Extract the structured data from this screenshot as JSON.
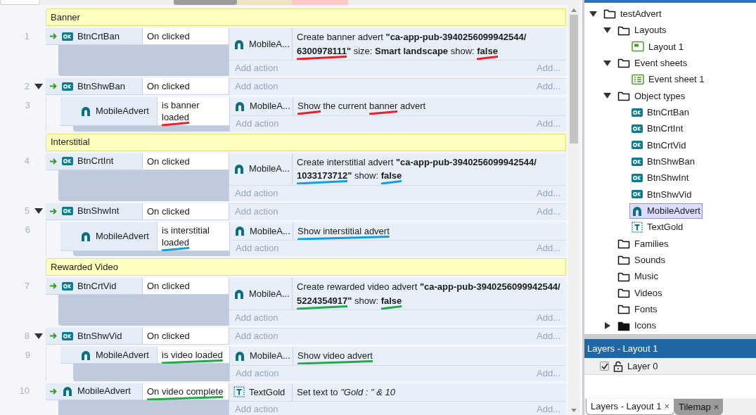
{
  "sheet": {
    "items": [
      {
        "kind": "group",
        "title": "Banner"
      },
      {
        "kind": "event",
        "number": "1",
        "trigger": true,
        "conditions": [
          {
            "kind": "button",
            "object": "BtnCrtBan",
            "text": [
              {
                "text": "On clicked"
              }
            ]
          }
        ],
        "actions": [
          {
            "kind": "advert",
            "object": "MobileA...",
            "text": [
              {
                "text": "Create banner advert "
              },
              {
                "text": "**\"ca-app-pub-**"
              },
              {
                "text": "**3940256099942544/**"
              },
              {
                "text": "**6300978111**",
                "color": "#e8202a"
              },
              {
                "text": "**\"** size: **Smart landscape** show: "
              },
              {
                "text": "**false**",
                "color": "#e8202a"
              }
            ]
          }
        ],
        "add_action": "Add action",
        "add_more": "Add..."
      },
      {
        "kind": "event",
        "number": "2",
        "trigger": true,
        "expanded": true,
        "conditions": [
          {
            "kind": "button",
            "object": "BtnShwBan",
            "text": [
              {
                "text": "On clicked"
              }
            ]
          }
        ],
        "add_action": "Add action",
        "add_more": "Add...",
        "children": [
          {
            "kind": "event",
            "number": "3",
            "trigger": false,
            "conditions": [
              {
                "kind": "advert",
                "object": "MobileAdvert",
                "text": [
                  {
                    "text": "is banner "
                  },
                  {
                    "text": "loaded",
                    "color": "#e8202a"
                  }
                ]
              }
            ],
            "actions": [
              {
                "kind": "advert",
                "object": "MobileA...",
                "text": [
                  {
                    "text": "Show",
                    "color": "#e8202a"
                  },
                  {
                    "text": " the current "
                  },
                  {
                    "text": "banner",
                    "color": "#e8202a"
                  },
                  {
                    "text": " advert"
                  }
                ]
              }
            ],
            "add_action": "Add action",
            "add_more": "Add..."
          }
        ]
      },
      {
        "kind": "group",
        "title": "Interstitial"
      },
      {
        "kind": "event",
        "number": "4",
        "trigger": true,
        "conditions": [
          {
            "kind": "button",
            "object": "BtnCrtInt",
            "text": [
              {
                "text": "On clicked"
              }
            ]
          }
        ],
        "actions": [
          {
            "kind": "advert",
            "object": "MobileA...",
            "text": [
              {
                "text": "Create interstitial advert "
              },
              {
                "text": "**\"ca-app-pub-**"
              },
              {
                "text": "**3940256099942544/**"
              },
              {
                "text": "**1033173712**",
                "color": "#129fe0"
              },
              {
                "text": "**\"** show: "
              },
              {
                "text": "**false**",
                "color": "#129fe0"
              }
            ]
          }
        ],
        "add_action": "Add action",
        "add_more": "Add..."
      },
      {
        "kind": "event",
        "number": "5",
        "trigger": true,
        "expanded": true,
        "conditions": [
          {
            "kind": "button",
            "object": "BtnShwInt",
            "text": [
              {
                "text": "On clicked"
              }
            ]
          }
        ],
        "add_action": "Add action",
        "add_more": "Add...",
        "children": [
          {
            "kind": "event",
            "number": "6",
            "trigger": false,
            "conditions": [
              {
                "kind": "advert",
                "object": "MobileAdvert",
                "text": [
                  {
                    "text": "is interstitial "
                  },
                  {
                    "text": "loaded",
                    "color": "#129fe0"
                  }
                ]
              }
            ],
            "actions": [
              {
                "kind": "advert",
                "object": "MobileA...",
                "text": [
                  {
                    "text": "Show interstitial advert",
                    "color": "#129fe0"
                  }
                ]
              }
            ],
            "add_action": "Add action",
            "add_more": "Add..."
          }
        ]
      },
      {
        "kind": "group",
        "title": "Rewarded Video"
      },
      {
        "kind": "event",
        "number": "7",
        "trigger": true,
        "conditions": [
          {
            "kind": "button",
            "object": "BtnCrtVid",
            "text": [
              {
                "text": "On clicked"
              }
            ]
          }
        ],
        "actions": [
          {
            "kind": "advert",
            "object": "MobileA...",
            "text": [
              {
                "text": "Create rewarded video advert "
              },
              {
                "text": "**\"ca-app-pub-**"
              },
              {
                "text": "**3940256099942544/**"
              },
              {
                "text": "**5224354917**",
                "color": "#23a94a"
              },
              {
                "text": "**\"** show: "
              },
              {
                "text": "**false**",
                "color": "#23a94a"
              }
            ]
          }
        ],
        "add_action": "Add action",
        "add_more": "Add..."
      },
      {
        "kind": "event",
        "number": "8",
        "trigger": true,
        "expanded": true,
        "conditions": [
          {
            "kind": "button",
            "object": "BtnShwVid",
            "text": [
              {
                "text": "On clicked"
              }
            ]
          }
        ],
        "add_action": "Add action",
        "add_more": "Add...",
        "children": [
          {
            "kind": "event",
            "number": "9",
            "trigger": false,
            "conditions": [
              {
                "kind": "advert",
                "object": "MobileAdvert",
                "text": [
                  {
                    "text": "is video loaded",
                    "color": "#23a94a"
                  }
                ]
              }
            ],
            "actions": [
              {
                "kind": "advert",
                "object": "MobileA...",
                "text": [
                  {
                    "text": "Show video advert",
                    "color": "#23a94a"
                  }
                ]
              }
            ],
            "add_action": "Add action",
            "add_more": "Add..."
          }
        ]
      },
      {
        "kind": "event",
        "number": "10",
        "trigger": true,
        "conditions": [
          {
            "kind": "advert",
            "object": "MobileAdvert",
            "text": [
              {
                "text": "On video complete",
                "color": "#23a94a"
              }
            ]
          }
        ],
        "actions": [
          {
            "kind": "text",
            "object": "TextGold",
            "text": [
              {
                "text": "Set text to *\"Gold : \" & 10*"
              }
            ]
          }
        ],
        "add_action": "Add action",
        "add_more": "Add..."
      }
    ]
  },
  "project_tree": [
    {
      "label": "testAdvert",
      "kind": "folder",
      "expanded": true,
      "selected": false,
      "children": [
        {
          "label": "Layouts",
          "kind": "folder",
          "expanded": true,
          "selected": false,
          "children": [
            {
              "label": "Layout 1",
              "kind": "layout",
              "selected": false
            }
          ]
        },
        {
          "label": "Event sheets",
          "kind": "folder",
          "expanded": true,
          "selected": false,
          "children": [
            {
              "label": "Event sheet 1",
              "kind": "eventsheet",
              "selected": false
            }
          ]
        },
        {
          "label": "Object types",
          "kind": "folder",
          "expanded": true,
          "selected": false,
          "children": [
            {
              "label": "BtnCrtBan",
              "kind": "button",
              "selected": false
            },
            {
              "label": "BtnCrtInt",
              "kind": "button",
              "selected": false
            },
            {
              "label": "BtnCrtVid",
              "kind": "button",
              "selected": false
            },
            {
              "label": "BtnShwBan",
              "kind": "button",
              "selected": false
            },
            {
              "label": "BtnShwInt",
              "kind": "button",
              "selected": false
            },
            {
              "label": "BtnShwVid",
              "kind": "button",
              "selected": false
            },
            {
              "label": "MobileAdvert",
              "kind": "advert",
              "selected": true
            },
            {
              "label": "TextGold",
              "kind": "text",
              "selected": false
            }
          ]
        },
        {
          "label": "Families",
          "kind": "folder",
          "selected": false
        },
        {
          "label": "Sounds",
          "kind": "folder",
          "selected": false
        },
        {
          "label": "Music",
          "kind": "folder",
          "selected": false
        },
        {
          "label": "Videos",
          "kind": "folder",
          "selected": false
        },
        {
          "label": "Fonts",
          "kind": "folder",
          "selected": false
        },
        {
          "label": "Icons",
          "kind": "folder-filled",
          "expanded": false,
          "selected": false
        }
      ]
    }
  ],
  "layers": {
    "title": "Layers - Layout 1",
    "rows": [
      {
        "name": "Layer 0",
        "visible": true,
        "locked": false
      }
    ]
  },
  "bottom_tabs": [
    {
      "label": "Layers - Layout 1",
      "close": "×",
      "selected": true
    },
    {
      "label": "Tilemap",
      "close": "×",
      "selected": false
    }
  ]
}
